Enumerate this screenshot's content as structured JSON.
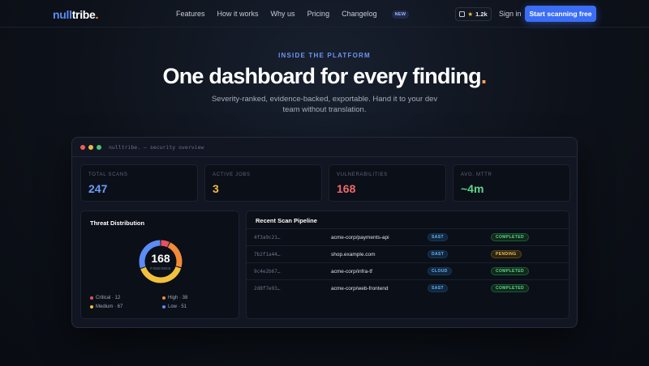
{
  "nav": {
    "logo_part1": "null",
    "logo_part2": "tribe",
    "logo_dot": ".",
    "links": [
      "Features",
      "How it works",
      "Why us",
      "Pricing",
      "Changelog"
    ],
    "changelog_badge": "NEW",
    "github_stars": "1.2k",
    "sign_in": "Sign in",
    "cta": "Start scanning free"
  },
  "hero": {
    "eyebrow": "INSIDE THE PLATFORM",
    "headline": "One dashboard for every finding",
    "headline_dot": ".",
    "subtitle": "Severity-ranked, evidence-backed, exportable. Hand it to your dev team without translation."
  },
  "dashboard": {
    "window_title": "nulltribe. — security overview",
    "stats": [
      {
        "label": "TOTAL SCANS",
        "value": "247",
        "color": "#6c9bf7"
      },
      {
        "label": "ACTIVE JOBS",
        "value": "3",
        "color": "#f0b93e"
      },
      {
        "label": "VULNERABILITIES",
        "value": "168",
        "color": "#ef6a6a"
      },
      {
        "label": "AVG. MTTR",
        "value": "~4m",
        "color": "#5fd58a"
      }
    ],
    "threat": {
      "title": "Threat Distribution",
      "total": "168",
      "total_label": "FINDINGS",
      "legend": [
        {
          "label": "Critical · 12",
          "value": 12,
          "color": "#e7505f"
        },
        {
          "label": "High · 38",
          "value": 38,
          "color": "#f28a3a"
        },
        {
          "label": "Medium · 67",
          "value": 67,
          "color": "#f2c13c"
        },
        {
          "label": "Low · 51",
          "value": 51,
          "color": "#5b8cf7"
        }
      ]
    },
    "pipeline": {
      "title": "Recent Scan Pipeline",
      "rows": [
        {
          "id": "4f3a9c21…",
          "repo": "acme-corp/payments-api",
          "type": "SAST",
          "status": "COMPLETED",
          "status_key": "completed"
        },
        {
          "id": "7b2f1a44…",
          "repo": "shop.example.com",
          "type": "DAST",
          "status": "PENDING",
          "status_key": "pending"
        },
        {
          "id": "9c4e2b67…",
          "repo": "acme-corp/infra-tf",
          "type": "CLOUD",
          "status": "COMPLETED",
          "status_key": "completed"
        },
        {
          "id": "2d8f7e93…",
          "repo": "acme-corp/web-frontend",
          "type": "SAST",
          "status": "COMPLETED",
          "status_key": "completed"
        }
      ]
    }
  }
}
